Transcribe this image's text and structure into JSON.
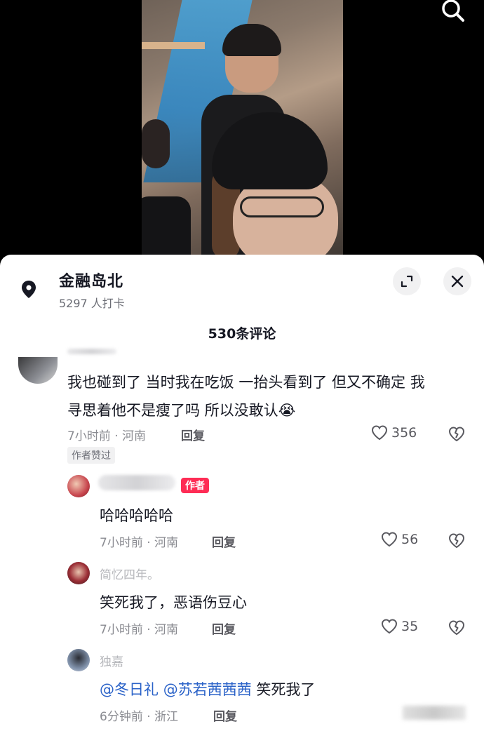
{
  "location": {
    "name": "金融岛北",
    "checkins": "5297 人打卡"
  },
  "comment_header": "530条评论",
  "comments": [
    {
      "text": "我也碰到了 当时我在吃饭 一抬头看到了 但又不确定 我寻思着他不是瘦了吗 所以没敢认😭",
      "line1": "我也碰到了 当时我在吃饭 一抬头看到了 但又不确定 我",
      "line2": "寻思着他不是瘦了吗 所以没敢认",
      "emoji": "😭",
      "time_location": "7小时前 · 河南",
      "reply_label": "回复",
      "likes": "356",
      "tag": "作者赞过"
    }
  ],
  "replies": [
    {
      "badge": "作者",
      "text": "哈哈哈哈哈",
      "time_location": "7小时前 · 河南",
      "reply_label": "回复",
      "likes": "56"
    },
    {
      "username": "简忆四年。",
      "text": "笑死我了，恶语伤豆心",
      "time_location": "7小时前 · 河南",
      "reply_label": "回复",
      "likes": "35"
    },
    {
      "username": "独嘉",
      "mention1": "@冬日礼",
      "mention2": "@苏若茜茜茜",
      "text": " 笑死我了",
      "time_location": "6分钟前 · 浙江",
      "reply_label": "回复"
    }
  ],
  "icons": {
    "search": "search-icon",
    "location": "location-pin-icon",
    "expand": "expand-icon",
    "close": "close-icon",
    "like": "heart-icon",
    "dislike": "broken-heart-icon"
  },
  "colors": {
    "accent": "#fe2c55",
    "mention": "#2a62c8"
  }
}
